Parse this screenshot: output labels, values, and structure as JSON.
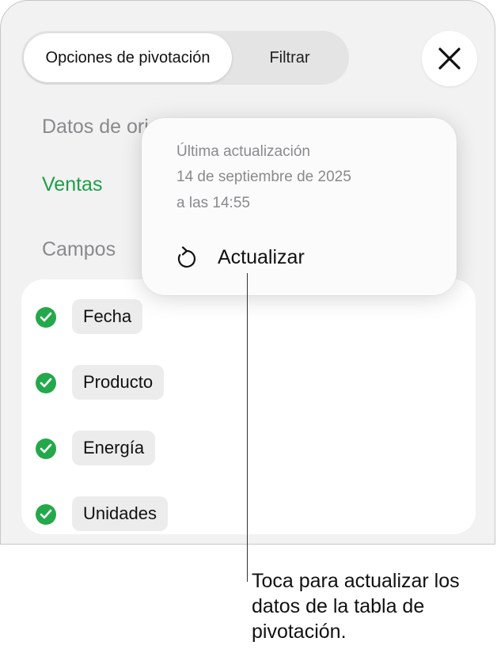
{
  "segmented": {
    "active_label": "Opciones de pivotación",
    "inactive_label": "Filtrar"
  },
  "source": {
    "label": "Datos de ori",
    "value": "Ventas"
  },
  "fields": {
    "label": "Campos",
    "items": [
      {
        "label": "Fecha",
        "checked": true
      },
      {
        "label": "Producto",
        "checked": true
      },
      {
        "label": "Energía",
        "checked": true
      },
      {
        "label": "Unidades",
        "checked": true
      }
    ]
  },
  "popover": {
    "line1": "Última actualización",
    "line2": "14 de septiembre de 2025",
    "line3": "a las 14:55",
    "action_label": "Actualizar"
  },
  "callout": {
    "text": "Toca para actualizar los datos de la tabla de pivotación."
  },
  "colors": {
    "accent": "#1f9e48",
    "check": "#23a94b"
  }
}
